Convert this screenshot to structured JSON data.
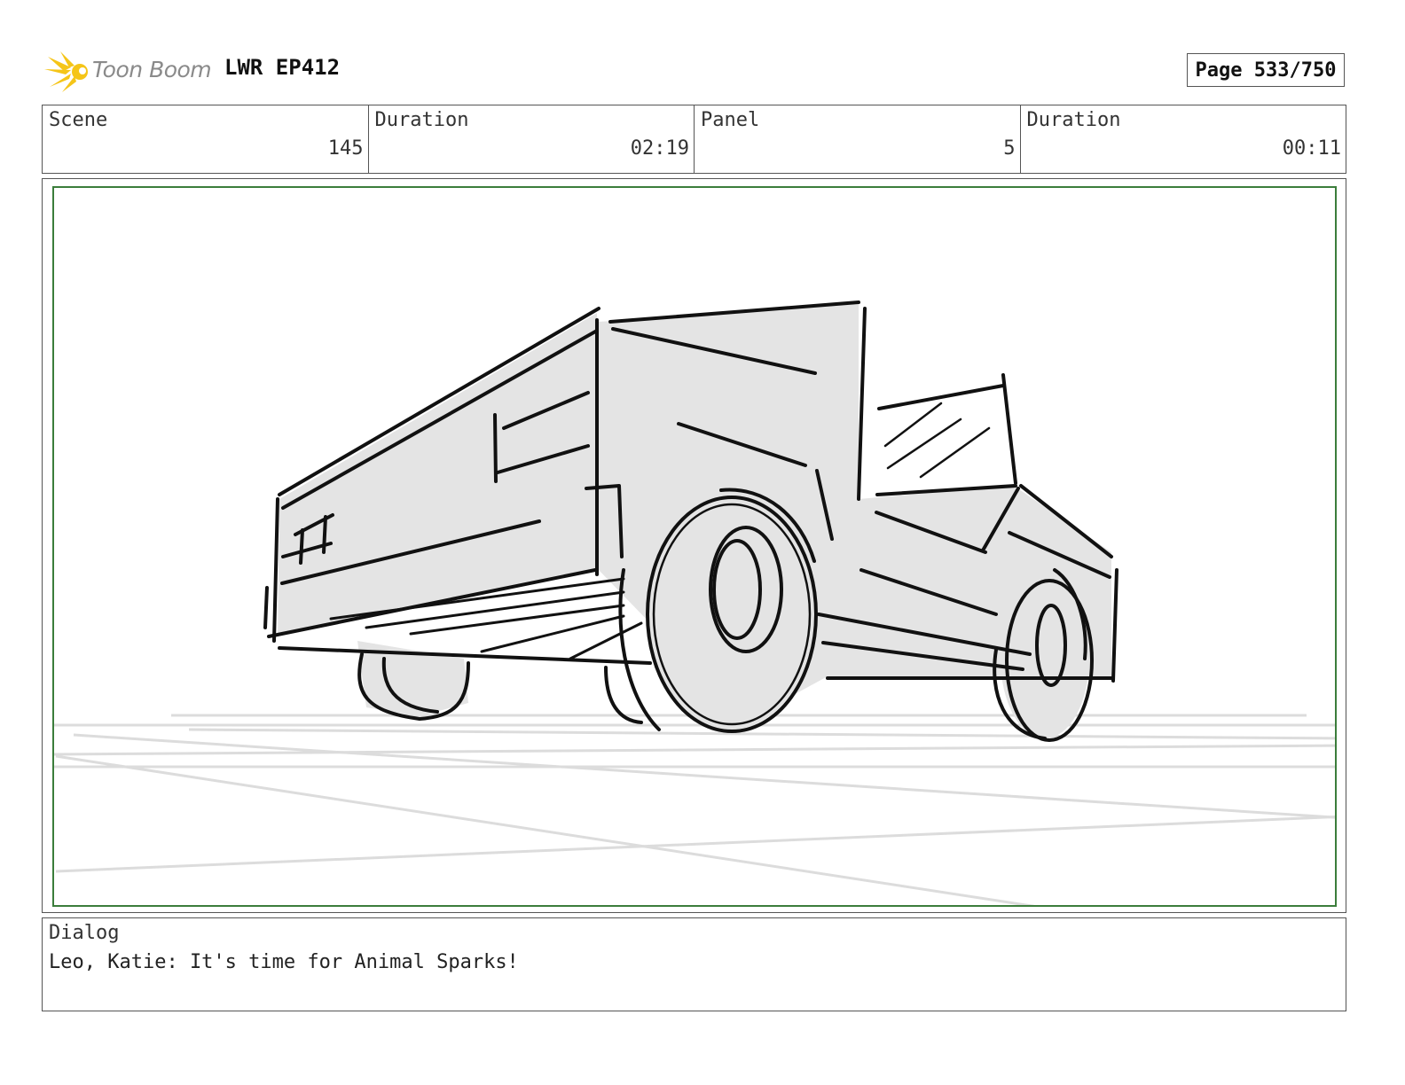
{
  "header": {
    "logo_text": "Toon Boom",
    "project": "LWR EP412",
    "page": "Page 533/750"
  },
  "info": {
    "scene_label": "Scene",
    "scene_value": "145",
    "scene_duration_label": "Duration",
    "scene_duration_value": "02:19",
    "panel_label": "Panel",
    "panel_value": "5",
    "panel_duration_label": "Duration",
    "panel_duration_value": "00:11"
  },
  "panel": {
    "image": "storyboard-sketch-truck-low-angle",
    "frame_color": "#3b7d3b"
  },
  "dialog": {
    "label": "Dialog",
    "text": "Leo, Katie: It's time for Animal Sparks!"
  },
  "colors": {
    "logo_accent": "#f5c518",
    "sketch_fill": "#e4e4e4",
    "sketch_line": "#111111"
  }
}
